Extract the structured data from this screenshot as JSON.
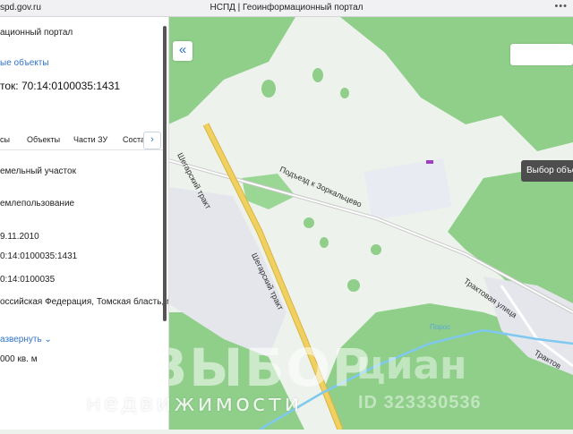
{
  "browser": {
    "url": "spd.gov.ru",
    "title": "НСПД | Геоинформационный портал",
    "window_controls": "•••"
  },
  "panel": {
    "portal_title": "ационный портал",
    "link": "ые объекты",
    "parcel_number": "ток: 70:14:0100035:1431",
    "tabs": [
      "сы",
      "Объекты",
      "Части ЗУ",
      "Соста"
    ],
    "tab_next": "›",
    "fields": [
      "емельный участок",
      "емлепользование",
      "9.11.2010",
      "0:14:0100035:1431",
      "0:14:0100035"
    ],
    "address": "оссийская Федерация, Томская бласть, муниципальный район омский, сельское поселение",
    "expand": "азвернуть",
    "expand_icon": "chevron-down-icon",
    "area": "000 кв. м"
  },
  "map": {
    "collapse_icon": "«",
    "select_objects_button": "Выбор объе",
    "road_labels": {
      "tract_1": "Шегарский тракт",
      "tract_2": "Шегарский тракт",
      "access_road": "Подъезд к Зоркальцево",
      "street": "Трактовая улица",
      "street_2": "Трактов",
      "river": "Порос"
    },
    "colors": {
      "forest": "#8fcf8a",
      "field": "#eef2ec",
      "highway": "#f0d060",
      "river": "#7fc8f0",
      "settlement": "#e4e6ec"
    }
  },
  "watermark": {
    "main": "ВЫБОР",
    "sub": "недвижимости",
    "brand": "циан",
    "id": "ID 323330536"
  }
}
